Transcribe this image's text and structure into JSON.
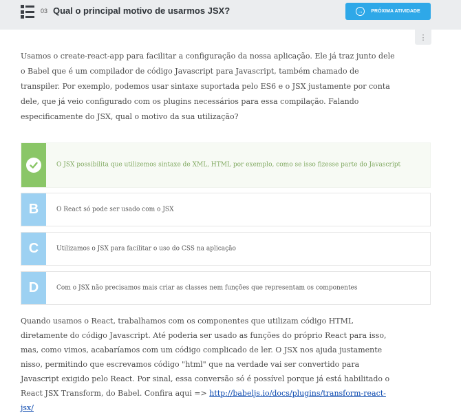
{
  "header": {
    "number": "03",
    "title": "Qual o principal motivo de usarmos JSX?",
    "next_label": "PRÓXIMA ATIVIDADE",
    "accent_color": "#2ea8e8"
  },
  "kebab_icon": "⋮",
  "question": "Usamos o create-react-app para facilitar a configuração da nossa aplicação. Ele já traz junto dele o Babel que é um compilador de código Javascript para Javascript, também chamado de transpiler. Por exemplo, podemos usar sintaxe suportada pelo ES6 e o JSX justamente por conta dele, que já veio configurado com os plugins necessários para essa compilação. Falando especificamente do JSX, qual o motivo da sua utilização?",
  "options": [
    {
      "letter": "",
      "text": "O JSX possibilita que utilizemos sintaxe de XML, HTML por exemplo, como se isso fizesse parte do Javascript",
      "correct": true
    },
    {
      "letter": "B",
      "text": "O React só pode ser usado com o JSX"
    },
    {
      "letter": "C",
      "text": "Utilizamos o JSX para facilitar o uso do CSS na aplicação"
    },
    {
      "letter": "D",
      "text": "Com o JSX não precisamos mais criar as classes nem funções que representam os componentes"
    }
  ],
  "explanation": {
    "text": "Quando usamos o React, trabalhamos com os componentes que utilizam código HTML diretamente do código Javascript. Até poderia ser usado as funções do próprio React para isso, mas, como vimos, acabaríamos com um código complicado de ler. O JSX nos ajuda justamente nisso, permitindo que escrevamos código \"html\" que na verdade vai ser convertido para Javascript exigido pelo React. Por sinal, essa conversão só é possível porque já está habilitado o React JSX Transform, do Babel. Confira aqui => ",
    "link_text": "http://babeljs.io/docs/plugins/transform-react-jsx/"
  },
  "colors": {
    "correct": "#8ac667",
    "option_letter": "#9dd1f2",
    "header_bg": "#ebedef"
  }
}
